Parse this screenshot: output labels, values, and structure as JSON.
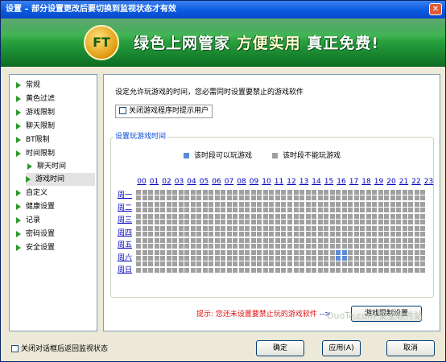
{
  "window": {
    "title": "设置 – 部分设置更改后要切换到监视状态才有效",
    "close_label": "✕"
  },
  "banner": {
    "logo_text": "FT",
    "slogan_part1": "绿色上网管家",
    "slogan_part2": "方便实用",
    "slogan_part3": "真正免费!"
  },
  "sidebar": {
    "items": [
      {
        "label": "常规"
      },
      {
        "label": "黄色过滤"
      },
      {
        "label": "游戏限制"
      },
      {
        "label": "聊天限制"
      },
      {
        "label": "BT限制"
      },
      {
        "label": "时间限制"
      },
      {
        "label": "聊天时间"
      },
      {
        "label": "游戏时间"
      },
      {
        "label": "自定义"
      },
      {
        "label": "健康设置"
      },
      {
        "label": "记录"
      },
      {
        "label": "密码设置"
      },
      {
        "label": "安全设置"
      }
    ]
  },
  "main": {
    "description": "设定允许玩游戏的时间，您必需同时设置要禁止的游戏软件",
    "close_prompt_checkbox": "关闭游戏程序时提示用户",
    "group_title": "设置玩游戏时间",
    "legend_allowed": "该时段可以玩游戏",
    "legend_blocked": "该时段不能玩游戏",
    "hours": [
      "00",
      "01",
      "02",
      "03",
      "04",
      "05",
      "06",
      "07",
      "08",
      "09",
      "10",
      "11",
      "12",
      "13",
      "14",
      "15",
      "16",
      "17",
      "18",
      "19",
      "20",
      "21",
      "22",
      "23"
    ],
    "days": [
      "周一",
      "周二",
      "周三",
      "周四",
      "周五",
      "周六",
      "周日"
    ],
    "hint": "提示: 您还未设置要禁止玩的游戏软件",
    "hint_arrow": "-->",
    "game_limit_button": "游戏限制设置"
  },
  "footer": {
    "return_checkbox": "关闭对话框后返回监视状态",
    "ok_button": "确定",
    "apply_button": "应用(A)",
    "cancel_button": "取消"
  },
  "watermark": "DuoTe.com 安全软件站",
  "colors": {
    "allowed": "#5a8ad8",
    "blocked": "#a0a0a0",
    "banner_green": "#2fae44",
    "titlebar_blue": "#0a5be0"
  }
}
